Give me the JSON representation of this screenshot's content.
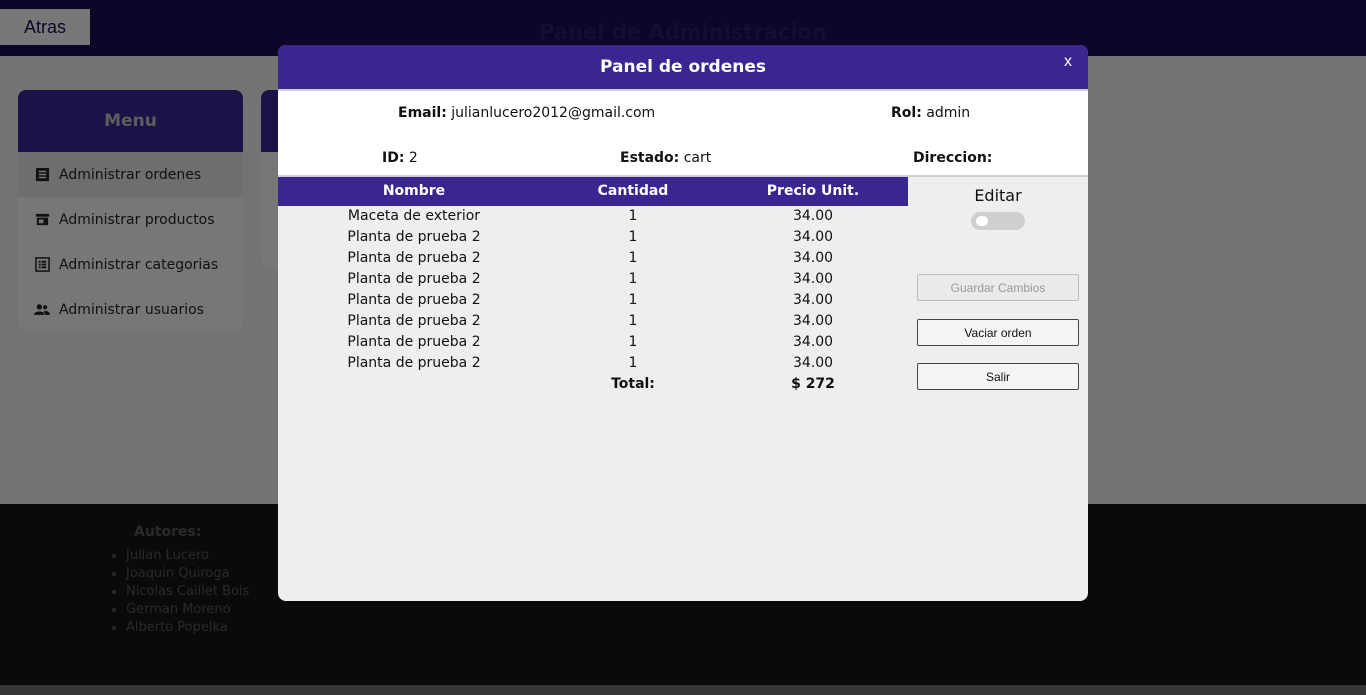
{
  "topbar": {
    "back_label": "Atras",
    "title": "Panel de Administracion"
  },
  "menu": {
    "title": "Menu",
    "items": [
      {
        "label": "Administrar ordenes",
        "icon": "list-icon"
      },
      {
        "label": "Administrar productos",
        "icon": "store-icon"
      },
      {
        "label": "Administrar categorias",
        "icon": "category-list-icon"
      },
      {
        "label": "Administrar usuarios",
        "icon": "users-icon"
      }
    ]
  },
  "footer": {
    "heading": "Autores:",
    "authors": [
      "Julian Lucero",
      "Joaquin Quiroga",
      "Nicolas Caillet Bois",
      "German Moreno",
      "Alberto Popelka"
    ]
  },
  "modal": {
    "title": "Panel de ordenes",
    "close_label": "x",
    "email_label": "Email:",
    "email_value": "julianlucero2012@gmail.com",
    "rol_label": "Rol:",
    "rol_value": "admin",
    "id_label": "ID:",
    "id_value": "2",
    "estado_label": "Estado:",
    "estado_value": "cart",
    "direccion_label": "Direccion:",
    "direccion_value": "",
    "table": {
      "headers": [
        "Nombre",
        "Cantidad",
        "Precio Unit."
      ],
      "rows": [
        [
          "Maceta de exterior",
          "1",
          "34.00"
        ],
        [
          "Planta de prueba 2",
          "1",
          "34.00"
        ],
        [
          "Planta de prueba 2",
          "1",
          "34.00"
        ],
        [
          "Planta de prueba 2",
          "1",
          "34.00"
        ],
        [
          "Planta de prueba 2",
          "1",
          "34.00"
        ],
        [
          "Planta de prueba 2",
          "1",
          "34.00"
        ],
        [
          "Planta de prueba 2",
          "1",
          "34.00"
        ],
        [
          "Planta de prueba 2",
          "1",
          "34.00"
        ]
      ],
      "total_label": "Total:",
      "total_value": "$ 272"
    },
    "edit_label": "Editar",
    "edit_enabled": false,
    "save_label": "Guardar Cambios",
    "empty_label": "Vaciar orden",
    "exit_label": "Salir"
  },
  "colors": {
    "primary": "#3a2591",
    "topbar": "#1b0c52"
  }
}
